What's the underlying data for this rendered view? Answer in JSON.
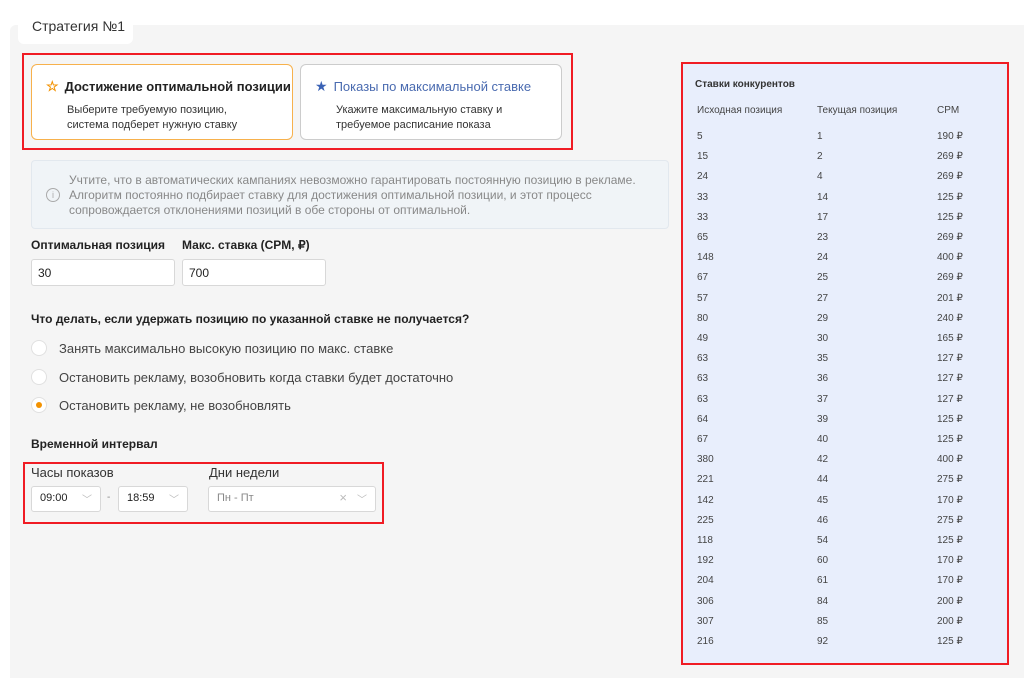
{
  "tab": "Стратегия №1",
  "strategies": [
    {
      "title": "Достижение оптимальной позиции",
      "desc1": "Выберите требуемую позицию,",
      "desc2": "система подберет нужную ставку",
      "icon": "star-half-icon",
      "selected": true
    },
    {
      "title": "Показы по максимальной ставке",
      "desc1": "Укажите максимальную ставку и",
      "desc2": "требуемое расписание показа",
      "icon": "star-icon",
      "selected": false
    }
  ],
  "info": {
    "line1": "Учтите, что в автоматических кампаниях невозможно гарантировать постоянную позицию в рекламе.",
    "line2": "Алгоритм постоянно подбирает ставку для достижения оптимальной позиции, и этот процесс",
    "line3": "сопровождается отклонениями позиций в обе стороны от оптимальной."
  },
  "fields": {
    "position_label": "Оптимальная позиция",
    "position_value": "30",
    "bid_label": "Макс. ставка (CPM, ₽)",
    "bid_value": "700"
  },
  "question": "Что делать, если удержать позицию по указанной ставке не получается?",
  "options": [
    "Занять максимально высокую позицию по макс. ставке",
    "Остановить рекламу, возобновить когда ставки будет достаточно",
    "Остановить рекламу, не возобновлять"
  ],
  "selected_option": 2,
  "interval": {
    "title": "Временной интервал",
    "hours_label": "Часы показов",
    "from": "09:00",
    "dash": "-",
    "to": "18:59",
    "days_label": "Дни недели",
    "days": "Пн - Пт"
  },
  "competitors": {
    "title": "Ставки конкурентов",
    "headers": [
      "Исходная позиция",
      "Текущая позиция",
      "CPM"
    ],
    "rows": [
      [
        "5",
        "1",
        "190 ₽"
      ],
      [
        "15",
        "2",
        "269 ₽"
      ],
      [
        "24",
        "4",
        "269 ₽"
      ],
      [
        "33",
        "14",
        "125 ₽"
      ],
      [
        "33",
        "17",
        "125 ₽"
      ],
      [
        "65",
        "23",
        "269 ₽"
      ],
      [
        "148",
        "24",
        "400 ₽"
      ],
      [
        "67",
        "25",
        "269 ₽"
      ],
      [
        "57",
        "27",
        "201 ₽"
      ],
      [
        "80",
        "29",
        "240 ₽"
      ],
      [
        "49",
        "30",
        "165 ₽"
      ],
      [
        "63",
        "35",
        "127 ₽"
      ],
      [
        "63",
        "36",
        "127 ₽"
      ],
      [
        "63",
        "37",
        "127 ₽"
      ],
      [
        "64",
        "39",
        "125 ₽"
      ],
      [
        "67",
        "40",
        "125 ₽"
      ],
      [
        "380",
        "42",
        "400 ₽"
      ],
      [
        "221",
        "44",
        "275 ₽"
      ],
      [
        "142",
        "45",
        "170 ₽"
      ],
      [
        "225",
        "46",
        "275 ₽"
      ],
      [
        "118",
        "54",
        "125 ₽"
      ],
      [
        "192",
        "60",
        "170 ₽"
      ],
      [
        "204",
        "61",
        "170 ₽"
      ],
      [
        "306",
        "84",
        "200 ₽"
      ],
      [
        "307",
        "85",
        "200 ₽"
      ],
      [
        "216",
        "92",
        "125 ₽"
      ]
    ]
  }
}
